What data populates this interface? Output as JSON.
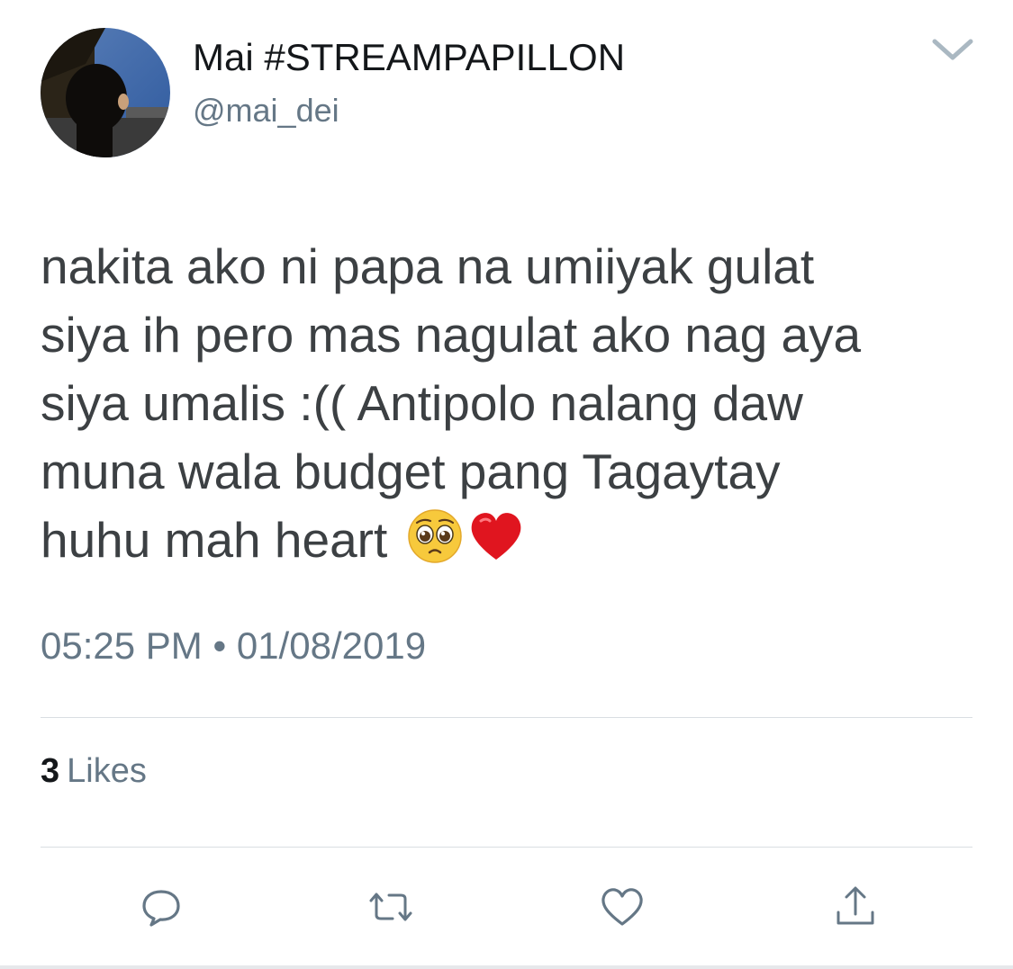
{
  "user": {
    "display_name": "Mai #STREAMPAPILLON",
    "handle": "@mai_dei"
  },
  "tweet": {
    "text": "nakita ako ni papa na umiiyak gulat\nsiya ih pero mas nagulat ako nag aya\nsiya umalis :(( Antipolo nalang daw\nmuna wala budget pang Tagaytay\nhuhu mah heart",
    "emojis": [
      "pleading-face",
      "red-heart"
    ],
    "time": "05:25 PM",
    "separator": "•",
    "date": "01/08/2019"
  },
  "stats": {
    "likes_count": "3",
    "likes_label": "Likes"
  },
  "actions": [
    "reply-icon",
    "retweet-icon",
    "like-icon",
    "share-icon"
  ],
  "colors": {
    "text_primary": "#14171a",
    "text_secondary": "#657786",
    "icon": "#657786",
    "divider": "#d9dee2"
  }
}
